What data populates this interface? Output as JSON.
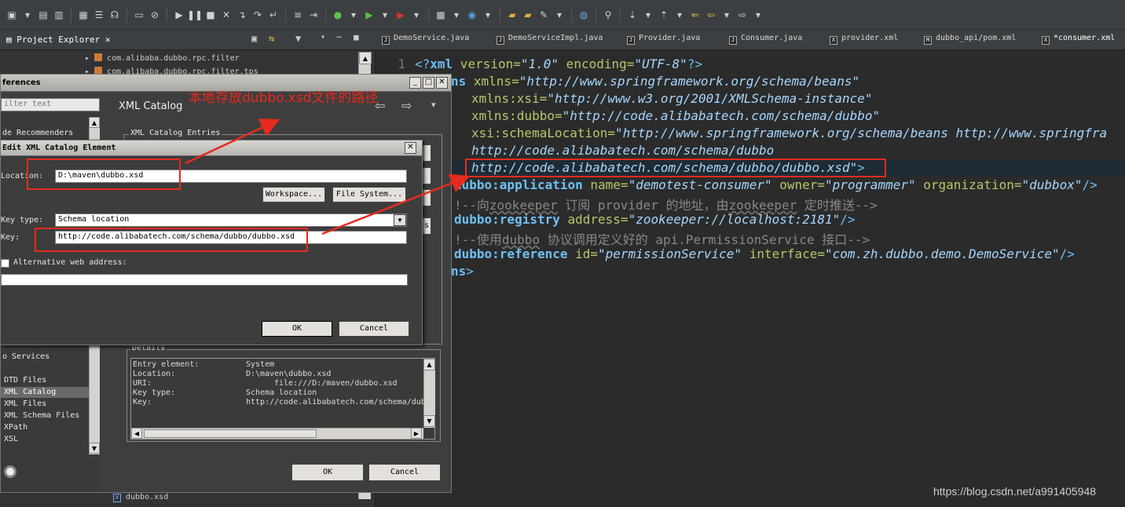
{
  "toolbar": {
    "icons": [
      "new-icon",
      "save-icon",
      "save-all-icon",
      "build-icon",
      "print-icon",
      "search-icon",
      "debug-icon",
      "run-icon",
      "run-alt-icon",
      "back-icon",
      "forward-icon"
    ]
  },
  "explorer": {
    "tab_label": "Project Explorer",
    "tree": [
      "com.alibaba.dubbo.rpc.filter",
      "com.alibaba.dubbo.rpc.filter.tps"
    ],
    "bottom_file": "dubbo.xsd"
  },
  "editor": {
    "tabs": [
      "DemoService.java",
      "DemoServiceImpl.java",
      "Provider.java",
      "Consumer.java",
      "provider.xml",
      "dubbo_api/pom.xml",
      "*consumer.xml"
    ],
    "line_number": "1",
    "lines": {
      "l1_open": "<?",
      "l1_tag": "xml",
      "l1_a1": " version=",
      "l1_v1": "\"1.0\"",
      "l1_a2": " encoding=",
      "l1_v2": "\"UTF-8\"",
      "l1_close": "?>",
      "l2_tag": "ns",
      "l2_attr": " xmlns=",
      "l2_val": "\"http://www.springframework.org/schema/beans\"",
      "l3_attr": "xmlns:xsi=",
      "l3_val": "\"http://www.w3.org/2001/XMLSchema-instance\"",
      "l4_attr": "xmlns:dubbo=",
      "l4_val": "\"http://code.alibabatech.com/schema/dubbo\"",
      "l5_attr": "xsi:schemaLocation=",
      "l5_val": "\"http://www.springframework.org/schema/beans http://www.springfra",
      "l6_val": "http://code.alibabatech.com/schema/dubbo",
      "l7_val": "http://code.alibabatech.com/schema/dubbo/dubbo.xsd\"",
      "l7_close": ">",
      "l8_tag": "dubbo:application",
      "l8_a1": " name=",
      "l8_v1": "\"demotest-consumer\"",
      "l8_a2": " owner=",
      "l8_v2": "\"programmer\"",
      "l8_a3": " organization=",
      "l8_v3": "\"dubbox\"",
      "l8_close": "/>",
      "l9_c1": "!--向",
      "l9_c2": "zookeeper",
      "l9_c3": " 订阅 provider 的地址，由",
      "l9_c4": "zookeeper",
      "l9_c5": " 定时推送-->",
      "l10_tag": "dubbo:registry",
      "l10_a1": " address=",
      "l10_v1": "\"zookeeper://localhost:2181\"",
      "l10_close": "/>",
      "l11_c1": "!--使用",
      "l11_c2": "dubbo",
      "l11_c3": " 协议调用定义好的 api.PermissionService 接口-->",
      "l12_tag": "dubbo:reference",
      "l12_a1": " id=",
      "l12_v1": "\"permissionService\"",
      "l12_a2": " interface=",
      "l12_v2": "\"com.zh.dubbo.demo.DemoService\"",
      "l12_close": "/>",
      "l13_tag": "ns",
      "l13_close": ">"
    }
  },
  "prefs": {
    "title": "ferences",
    "filter_placeholder": "ilter text",
    "list_top": [
      "",
      "de Recommenders"
    ],
    "list_bottom": [
      "o Services",
      "",
      "DTD Files",
      "XML Catalog",
      "XML Files",
      "XML Schema Files",
      "XPath",
      "XSL"
    ],
    "page_title": "XML Catalog",
    "group_label": "XML Catalog Entries",
    "details_label": "Details",
    "details": [
      {
        "k": "Entry element:",
        "v": "System"
      },
      {
        "k": "Location:",
        "v": "D:\\maven\\dubbo.xsd"
      },
      {
        "k": "URI:",
        "v": "file:///D:/maven/dubbo.xsd"
      },
      {
        "k": "Key type:",
        "v": "Schema location"
      },
      {
        "k": "Key:",
        "v": "http://code.alibabatech.com/schema/dub"
      }
    ],
    "side_btn": "s",
    "ok": "OK",
    "cancel": "Cancel"
  },
  "edit_dialog": {
    "title": "Edit XML Catalog Element",
    "location_label": "Location:",
    "location_value": "D:\\maven\\dubbo.xsd",
    "workspace_btn": "Workspace...",
    "filesystem_btn": "File System...",
    "keytype_label": "Key type:",
    "keytype_value": "Schema location",
    "key_label": "Key:",
    "key_value": "http://code.alibabatech.com/schema/dubbo/dubbo.xsd",
    "alt_label": "Alternative web address:",
    "alt_value": "",
    "ok": "OK",
    "cancel": "Cancel"
  },
  "annotation": {
    "text": "本地存放dubbo.xsd文件的路径",
    "color": "#e52b1f"
  },
  "watermark": "https://blog.csdn.net/a991405948"
}
